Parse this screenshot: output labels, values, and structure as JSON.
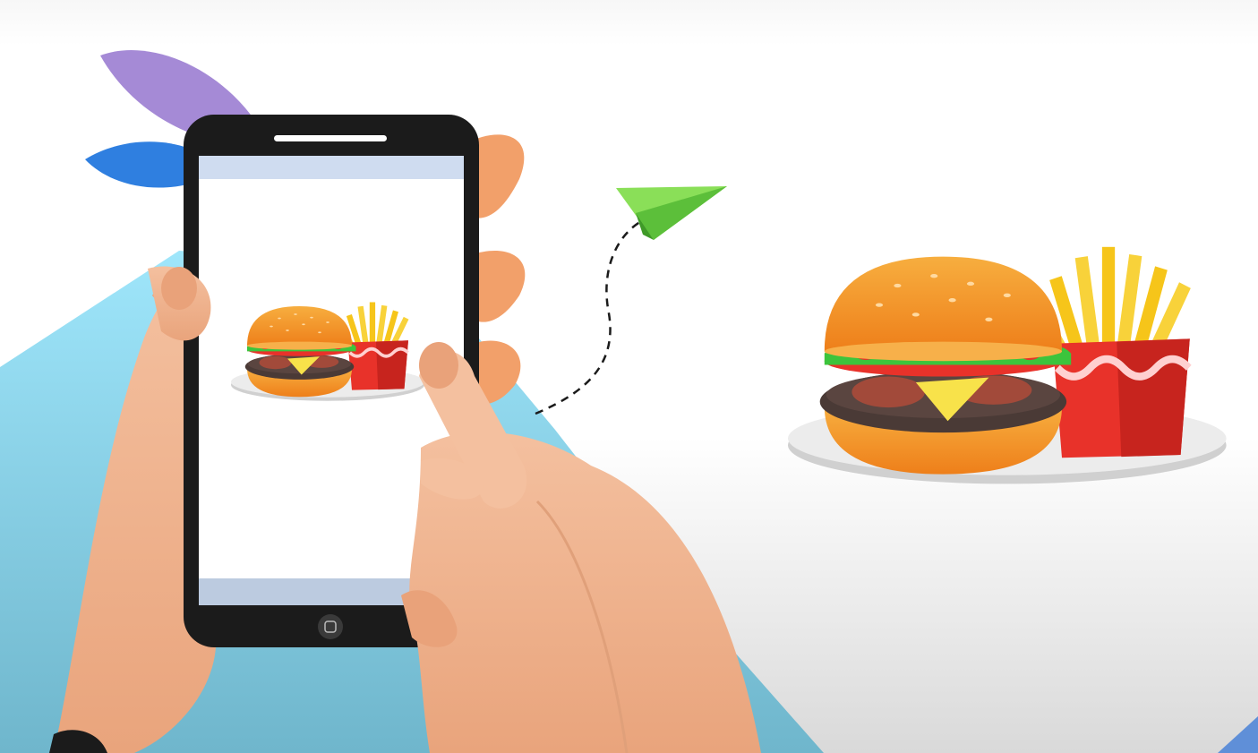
{
  "scene": {
    "description_free": true,
    "colors": {
      "skin": "#f2b896",
      "skin_shadow": "#e89a70",
      "phone_body": "#1b1b1b",
      "phone_screen": "#ffffff",
      "screen_bar": "#c9d8ee",
      "mountain": "#8fdcf5",
      "bun": "#f29a2e",
      "patty": "#4a3a36",
      "lettuce": "#3cc43c",
      "tomato": "#e8322a",
      "fries": "#f6c51a",
      "fries_box": "#e8322a",
      "plate": "#e8e8e8",
      "paper_plane": "#7ad44a",
      "leaf_purple": "#a58ad6",
      "leaf_blue": "#2f7fe0"
    },
    "icons": [
      "paper-plane-icon",
      "home-button-icon"
    ]
  }
}
